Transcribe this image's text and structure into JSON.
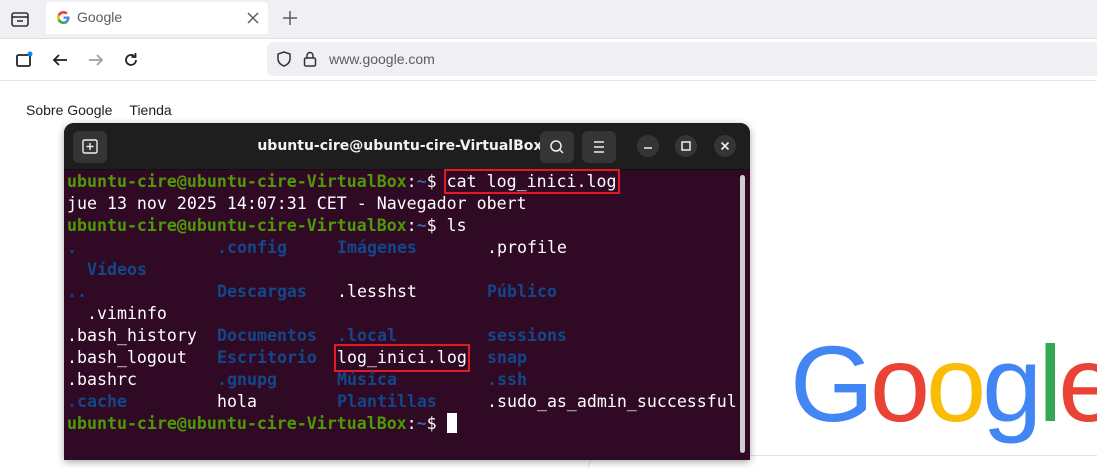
{
  "browser": {
    "tab_title": "Google",
    "url": "www.google.com"
  },
  "google": {
    "links": [
      "Sobre Google",
      "Tienda"
    ],
    "logo_letters": [
      "G",
      "o",
      "o",
      "g",
      "l",
      "e"
    ],
    "logo_colors": [
      "#4285f4",
      "#ea4335",
      "#fbbc05",
      "#4285f4",
      "#34a853",
      "#ea4335"
    ]
  },
  "terminal": {
    "title": "ubuntu-cire@ubuntu-cire-VirtualBox: ~",
    "prompt_user": "ubuntu-cire@ubuntu-cire-VirtualBox",
    "prompt_colon": ":",
    "prompt_path": "~",
    "prompt_dollar": "$ ",
    "cmd1": "cat log_inici.log",
    "output1": "jue 13 nov 2025 14:07:31 CET - Navegador obert",
    "cmd2": "ls",
    "ls": {
      "r1": [
        ".",
        ".config",
        "Imágenes",
        ".profile"
      ],
      "r2": [
        "Vídeos"
      ],
      "r3": [
        "..",
        "Descargas",
        ".lesshst",
        "Público"
      ],
      "r4": [
        ".viminfo"
      ],
      "r5": [
        ".bash_history",
        "Documentos",
        ".local",
        "sessions"
      ],
      "r6": [
        ".bash_logout",
        "Escritorio",
        "log_inici.log",
        "snap"
      ],
      "r7": [
        ".bashrc",
        ".gnupg",
        "Música",
        ".ssh"
      ],
      "r8": [
        ".cache",
        "hola",
        "Plantillas",
        ".sudo_as_admin_successful"
      ]
    }
  },
  "colors": {
    "terminal_bg": "#300a24",
    "prompt_user": "#4e9a06",
    "prompt_path": "#3465a4",
    "directory": "#12488b",
    "highlight_box": "#e01b24"
  }
}
